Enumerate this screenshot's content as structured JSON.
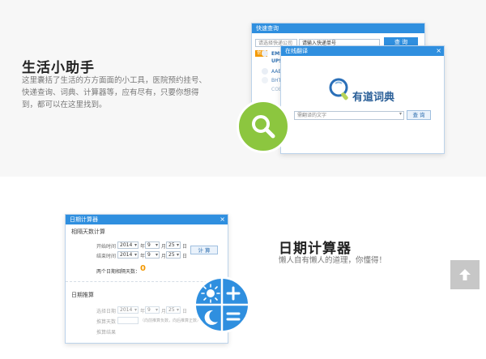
{
  "life_helper": {
    "title": "生活小助手",
    "desc": "这里囊括了生活的方方面面的小工具，医院预约挂号、快递查询、词典、计算器等，应有尽有，只要你想得到，都可以在这里找到。"
  },
  "express_window": {
    "title": "快速查询",
    "select_placeholder": "请选择快递公司",
    "number_placeholder": "请输入快递单号",
    "query_label": "查 询",
    "couriers": [
      "EMS",
      "UPS",
      "AAE",
      "BHT",
      "COE"
    ],
    "badge": "常用"
  },
  "dict_window": {
    "title": "在线翻译",
    "logo_text": "有道词典",
    "input_placeholder": "需翻译的文字",
    "query_label": "查 询"
  },
  "date_calc": {
    "title": "日期计算器",
    "desc": "懒人自有懒人的道理，你懂得！",
    "window": {
      "title": "日期计算器",
      "section1": "相隔天数计算",
      "start_label": "开始时间",
      "end_label": "结束时间",
      "start": {
        "year": "2014",
        "month": "9",
        "day": "25"
      },
      "end": {
        "year": "2014",
        "month": "9",
        "day": "25"
      },
      "unit_year": "年",
      "unit_month": "月",
      "unit_day": "日",
      "calc_label": "计 算",
      "result_label": "两个日期相隔天数：",
      "result_value": "0",
      "section2": "日期推算",
      "base_label": "选择日期",
      "base": {
        "year": "2014",
        "month": "9",
        "day": "25"
      },
      "offset_label": "推算天数",
      "offset_hint": "（向前推算负数，向后推算正数）",
      "result2_label": "推算结果"
    }
  },
  "colors": {
    "accent_green": "#8cc63f",
    "accent_blue": "#2f8fdf",
    "result_orange": "#f39800"
  },
  "icons": {
    "search": "magnifier",
    "sun": "sun",
    "moon": "moon",
    "plus": "plus",
    "equals": "equals",
    "scroll_top": "arrow-up"
  }
}
